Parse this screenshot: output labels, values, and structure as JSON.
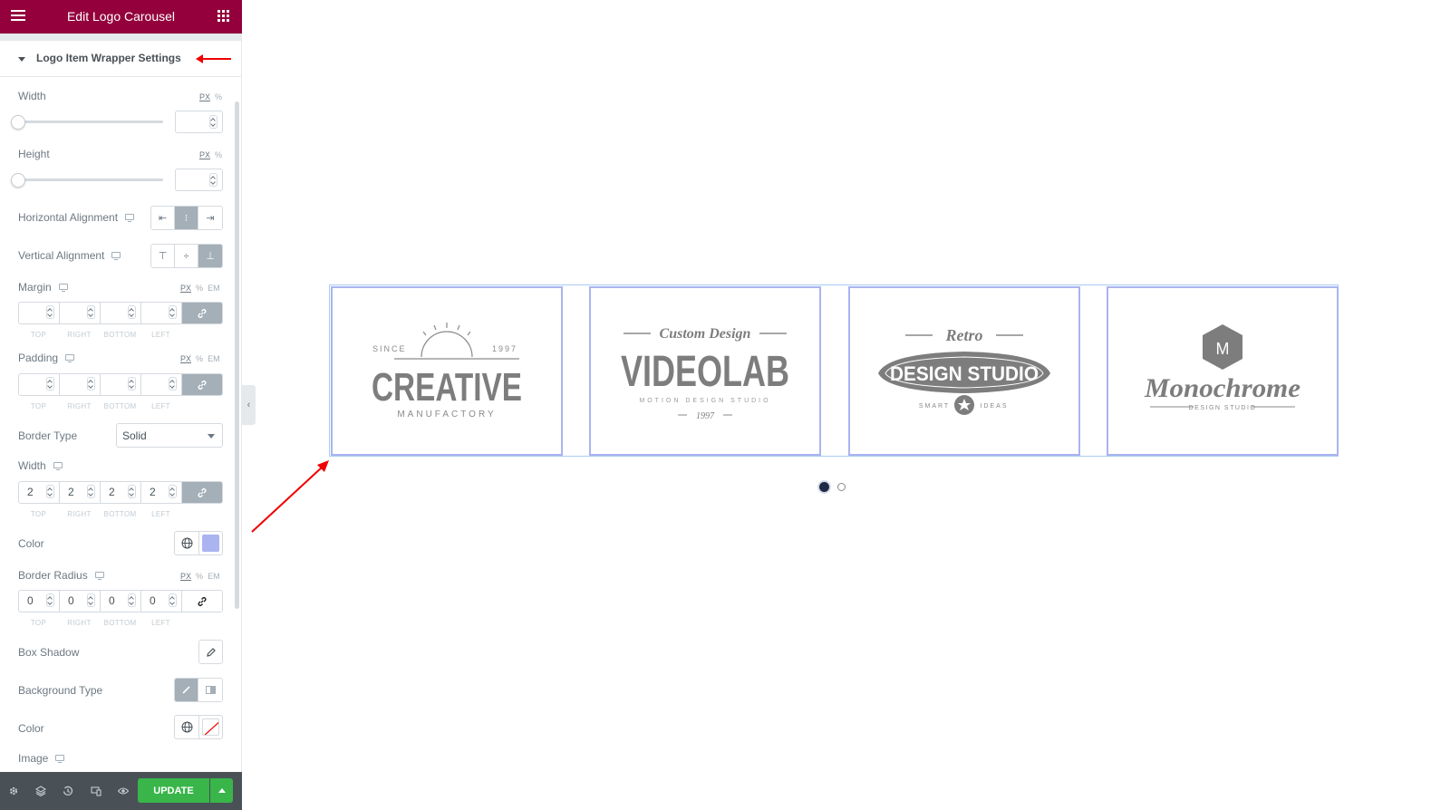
{
  "header": {
    "title": "Edit Logo Carousel",
    "menu_icon": "hamburger-icon",
    "apps_icon": "grid-icon"
  },
  "section": {
    "title": "Logo Item Wrapper Settings"
  },
  "controls": {
    "width_label": "Width",
    "height_label": "Height",
    "unit_px": "PX",
    "unit_pct": "%",
    "unit_em": "EM",
    "horizontal_alignment_label": "Horizontal Alignment",
    "vertical_alignment_label": "Vertical Alignment",
    "margin_label": "Margin",
    "padding_label": "Padding",
    "border_type_label": "Border Type",
    "border_type_value": "Solid",
    "border_width_label": "Width",
    "border_width": {
      "top": "2",
      "right": "2",
      "bottom": "2",
      "left": "2"
    },
    "color_label": "Color",
    "border_color": "#aab4f0",
    "border_radius_label": "Border Radius",
    "border_radius": {
      "top": "0",
      "right": "0",
      "bottom": "0",
      "left": "0"
    },
    "box_shadow_label": "Box Shadow",
    "background_type_label": "Background Type",
    "bg_color_label": "Color",
    "image_label": "Image",
    "dim_top": "TOP",
    "dim_right": "RIGHT",
    "dim_bottom": "BOTTOM",
    "dim_left": "LEFT"
  },
  "footer": {
    "update_label": "UPDATE"
  },
  "carousel": {
    "logos": [
      {
        "top": "SINCE",
        "year": "1997",
        "main": "CREATIVE",
        "sub": "MANUFACTORY"
      },
      {
        "top": "Custom Design",
        "main": "VIDEOLAB",
        "sub": "MOTION DESIGN STUDIO",
        "year": "1997"
      },
      {
        "top": "Retro",
        "main": "DESIGN STUDIO",
        "left": "SMART",
        "right": "IDEAS"
      },
      {
        "badge": "M",
        "main": "Monochrome",
        "sub": "DESIGN STUDIO"
      }
    ],
    "active_page": 1,
    "pages": 2
  },
  "colors": {
    "brand": "#93003c",
    "update": "#39b54a",
    "logo_gray": "#7a7a7a"
  }
}
